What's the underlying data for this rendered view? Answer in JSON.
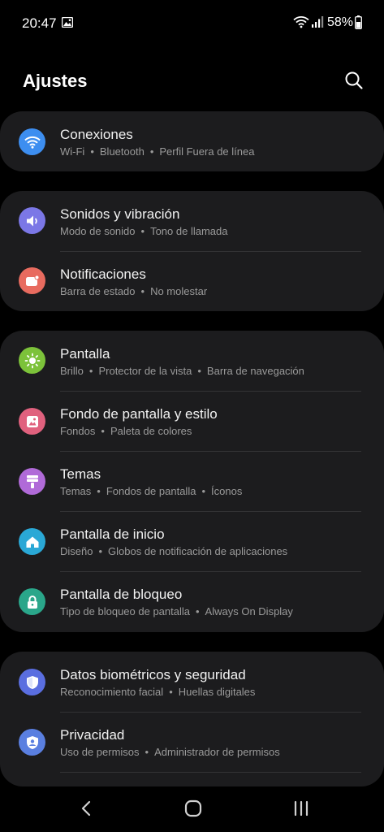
{
  "status": {
    "time": "20:47",
    "battery": "58%"
  },
  "header": {
    "title": "Ajustes"
  },
  "cards": [
    {
      "items": [
        {
          "title": "Conexiones",
          "subs": [
            "Wi-Fi",
            "Bluetooth",
            "Perfil Fuera de línea"
          ],
          "icon": "wifi-icon",
          "color": "#3d8ef0"
        }
      ]
    },
    {
      "items": [
        {
          "title": "Sonidos y vibración",
          "subs": [
            "Modo de sonido",
            "Tono de llamada"
          ],
          "icon": "speaker-icon",
          "color": "#7b77e6"
        },
        {
          "title": "Notificaciones",
          "subs": [
            "Barra de estado",
            "No molestar"
          ],
          "icon": "notification-icon",
          "color": "#e86b5f"
        }
      ]
    },
    {
      "items": [
        {
          "title": "Pantalla",
          "subs": [
            "Brillo",
            "Protector de la vista",
            "Barra de navegación"
          ],
          "icon": "brightness-icon",
          "color": "#7cc23a"
        },
        {
          "title": "Fondo de pantalla y estilo",
          "subs": [
            "Fondos",
            "Paleta de colores"
          ],
          "icon": "wallpaper-icon",
          "color": "#e0617e"
        },
        {
          "title": "Temas",
          "subs": [
            "Temas",
            "Fondos de pantalla",
            "Íconos"
          ],
          "icon": "themes-icon",
          "color": "#b06ad8"
        },
        {
          "title": "Pantalla de inicio",
          "subs": [
            "Diseño",
            "Globos de notificación de aplicaciones"
          ],
          "icon": "home-screen-icon",
          "color": "#2aa8d6"
        },
        {
          "title": "Pantalla de bloqueo",
          "subs": [
            "Tipo de bloqueo de pantalla",
            "Always On Display"
          ],
          "icon": "lock-icon",
          "color": "#2aa68a"
        }
      ]
    },
    {
      "items": [
        {
          "title": "Datos biométricos y seguridad",
          "subs": [
            "Reconocimiento facial",
            "Huellas digitales"
          ],
          "icon": "shield-icon",
          "color": "#5a6ee0"
        },
        {
          "title": "Privacidad",
          "subs": [
            "Uso de permisos",
            "Administrador de permisos"
          ],
          "icon": "privacy-icon",
          "color": "#5a7fe0"
        }
      ]
    }
  ]
}
